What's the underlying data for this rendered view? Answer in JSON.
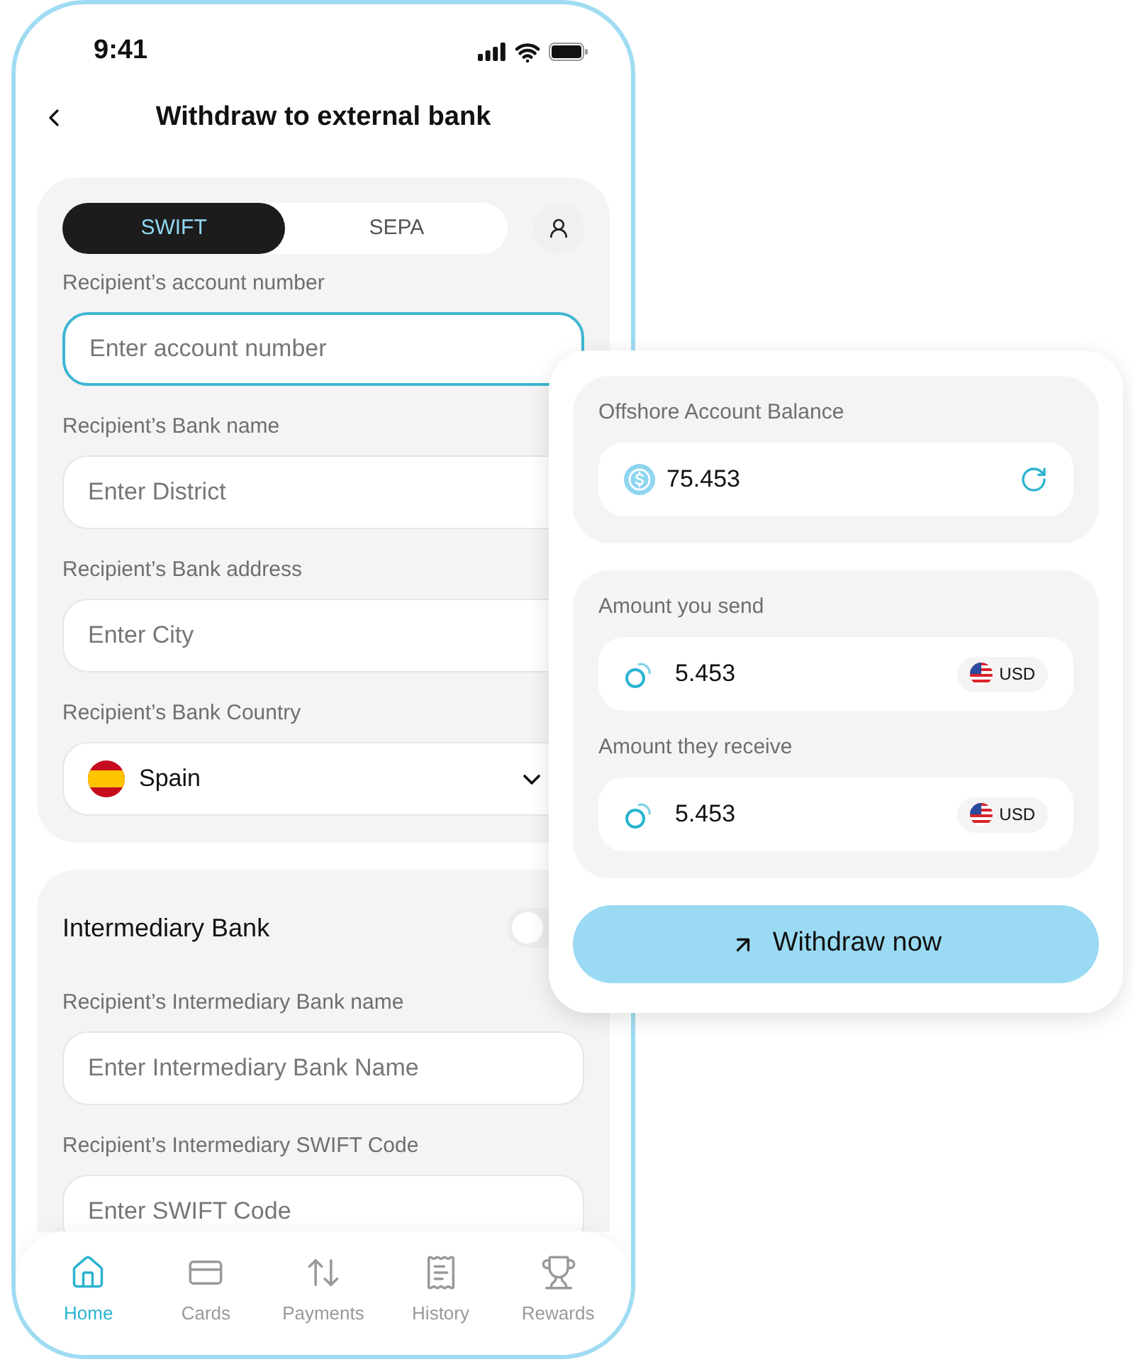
{
  "status_bar": {
    "time": "9:41"
  },
  "header": {
    "title": "Withdraw to external bank"
  },
  "tabs": [
    {
      "label": "SWIFT",
      "selected": true
    },
    {
      "label": "SEPA",
      "selected": false
    }
  ],
  "recipient_fields": [
    {
      "kind": "text",
      "label": "Recipient’s account number",
      "placeholder": "Enter account number",
      "focused": true
    },
    {
      "kind": "text",
      "label": "Recipient’s Bank name",
      "placeholder": "Enter District",
      "focused": false
    },
    {
      "kind": "text",
      "label": "Recipient’s Bank address",
      "placeholder": "Enter City",
      "focused": false
    },
    {
      "kind": "select",
      "label": "Recipient’s Bank Country",
      "value": "Spain",
      "focused": false
    }
  ],
  "intermediary": {
    "title": "Intermediary Bank",
    "on": false,
    "fields": [
      {
        "kind": "text",
        "label": "Recipient’s Intermediary Bank name",
        "placeholder": "Enter Intermediary Bank Name",
        "focused": false
      },
      {
        "kind": "text",
        "label": "Recipient’s Intermediary SWIFT Code",
        "placeholder": "Enter SWIFT Code",
        "focused": false
      }
    ]
  },
  "nav": [
    {
      "label": "Home",
      "selected": true
    },
    {
      "label": "Cards",
      "selected": false
    },
    {
      "label": "Payments",
      "selected": false
    },
    {
      "label": "History",
      "selected": false
    },
    {
      "label": "Rewards",
      "selected": false
    }
  ],
  "summary": {
    "balance": {
      "label": "Offshore Account Balance",
      "value": "75.453"
    },
    "amounts": [
      {
        "label": "Amount you send",
        "value": "5.453",
        "currency": "USD"
      },
      {
        "label": "Amount they receive",
        "value": "5.453",
        "currency": "USD"
      }
    ],
    "button": "Withdraw now"
  }
}
